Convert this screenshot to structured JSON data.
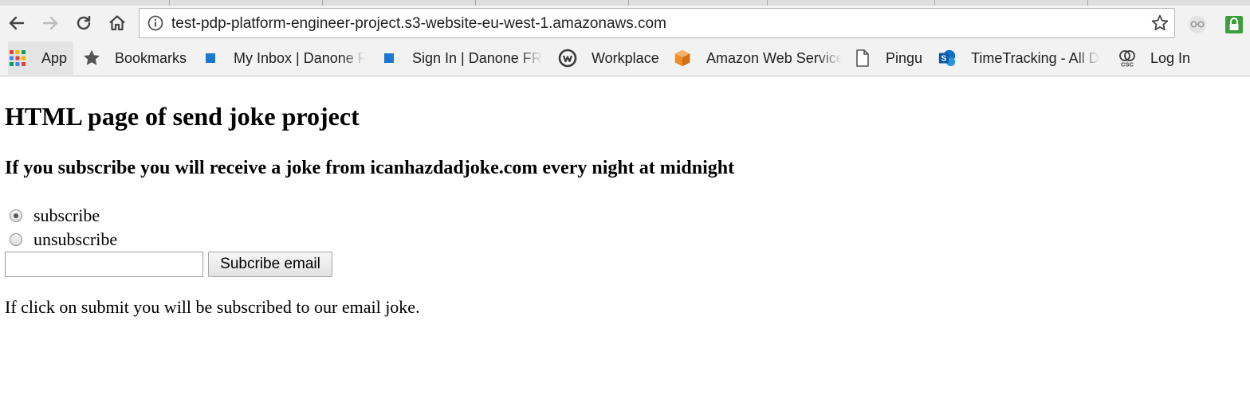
{
  "browser": {
    "url": "test-pdp-platform-engineer-project.s3-website-eu-west-1.amazonaws.com",
    "bookmarks": [
      {
        "label": "App",
        "icon": "apps-grid-icon"
      },
      {
        "label": "Bookmarks",
        "icon": "star-icon"
      },
      {
        "label": "My Inbox | Danone F",
        "icon": "blue-square-icon"
      },
      {
        "label": "Sign In | Danone FR",
        "icon": "blue-square-icon"
      },
      {
        "label": "Workplace",
        "icon": "workplace-icon"
      },
      {
        "label": "Amazon Web Service",
        "icon": "aws-cube-icon"
      },
      {
        "label": "Pingu",
        "icon": "document-icon"
      },
      {
        "label": "TimeTracking - All D",
        "icon": "sharepoint-icon"
      },
      {
        "label": "Log In",
        "icon": "csc-icon"
      }
    ],
    "colors": {
      "chrome_bg": "#f2f2f2",
      "bookmark_blue": "#1b77cf",
      "aws_orange": "#f08a24",
      "lock_green": "#3c9d3c"
    }
  },
  "page": {
    "title": "HTML page of send joke project",
    "subtitle": "If you subscribe you will receive a joke from icanhazdadjoke.com every night at midnight",
    "options": [
      {
        "label": "subscribe",
        "checked": true
      },
      {
        "label": "unsubscribe",
        "checked": false
      }
    ],
    "email_value": "",
    "submit_label": "Subcribe email",
    "note": "If click on submit you will be subscribed to our email joke."
  }
}
